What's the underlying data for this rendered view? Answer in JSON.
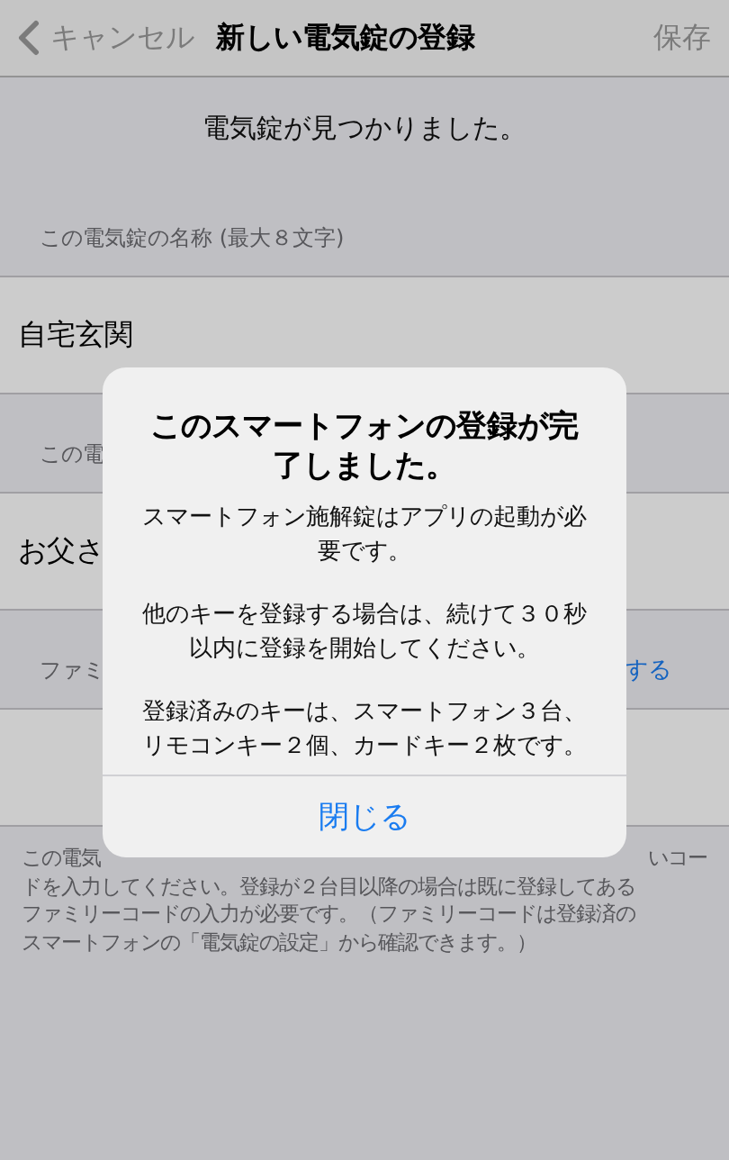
{
  "nav": {
    "back": "キャンセル",
    "title": "新しい電気錠の登録",
    "save": "保存"
  },
  "message": "電気錠が見つかりました。",
  "sections": [
    {
      "kind": "label",
      "left": "この電気錠の名称 (最大８文字)"
    },
    {
      "kind": "row",
      "left": "自宅玄関"
    },
    {
      "kind": "label",
      "left": "この電"
    },
    {
      "kind": "row",
      "left": "お父さ"
    },
    {
      "kind": "label",
      "left": "ファミ",
      "link": "する"
    },
    {
      "kind": "row"
    }
  ],
  "footer": {
    "first_left": "この電気",
    "first_right": "いコー",
    "lines": [
      "ドを入力してください。登録が２台目以降の場合は既に登録してある",
      "ファミリーコードの入力が必要です。（ファミリーコードは登録済の",
      "スマートフォンの「電気錠の設定」から確認できます。）"
    ]
  },
  "alert": {
    "title": "このスマートフォンの登録が完了しました。",
    "paragraphs": [
      "スマートフォン施解錠はアプリの起動が必要です。",
      "他のキーを登録する場合は、続けて３０秒以内に登録を開始してください。",
      "登録済みのキーは、スマートフォン３台、リモコンキー２個、カードキー２枚です。"
    ],
    "button": "閉じる"
  }
}
